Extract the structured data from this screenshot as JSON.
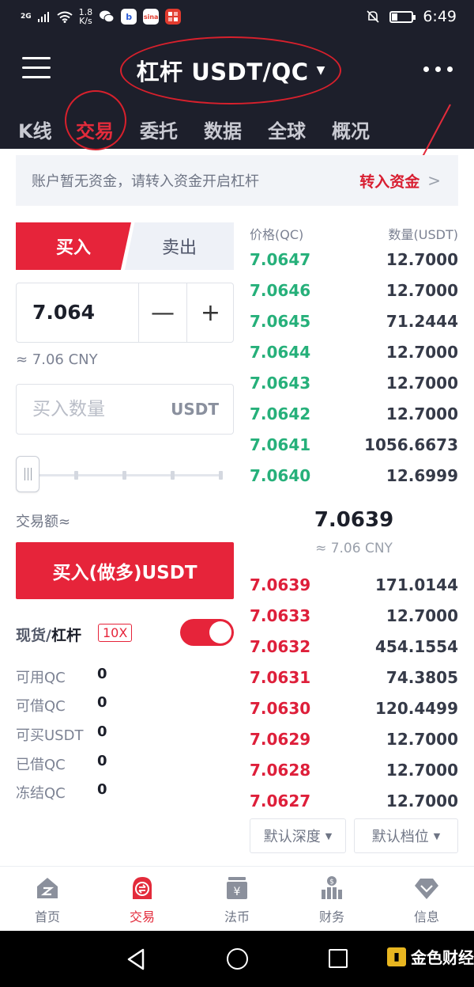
{
  "status_bar": {
    "signal": "2G",
    "net_speed": "1.8",
    "net_unit": "K/s",
    "time": "6:49",
    "battery_level": 0.3
  },
  "header": {
    "title": "杠杆 USDT/QC",
    "tabs": [
      {
        "label": "K线",
        "active": false
      },
      {
        "label": "交易",
        "active": true
      },
      {
        "label": "委托",
        "active": false
      },
      {
        "label": "数据",
        "active": false
      },
      {
        "label": "全球",
        "active": false
      },
      {
        "label": "概况",
        "active": false
      }
    ]
  },
  "notice": {
    "text": "账户暂无资金，请转入资金开启杠杆",
    "link": "转入资金"
  },
  "trade": {
    "buy_tab": "买入",
    "sell_tab": "卖出",
    "price_value": "7.064",
    "minus": "—",
    "plus": "+",
    "cny_hint": "≈ 7.06 CNY",
    "qty_placeholder": "买入数量",
    "qty_unit": "USDT",
    "slider_value": 0,
    "amount_label": "交易额≈",
    "buy_button": "买入(做多)USDT",
    "margin_spot": "现货/",
    "margin_lev": "杠杆",
    "leverage": "10X",
    "toggle_on": true,
    "balances": [
      {
        "label": "可用QC",
        "value": "0"
      },
      {
        "label": "可借QC",
        "value": "0"
      },
      {
        "label": "可买USDT",
        "value": "0"
      },
      {
        "label": "已借QC",
        "value": "0"
      },
      {
        "label": "冻结QC",
        "value": "0"
      }
    ]
  },
  "orderbook": {
    "price_header": "价格(QC)",
    "qty_header": "数量(USDT)",
    "asks": [
      {
        "price": "7.0647",
        "qty": "12.7000"
      },
      {
        "price": "7.0646",
        "qty": "12.7000"
      },
      {
        "price": "7.0645",
        "qty": "71.2444"
      },
      {
        "price": "7.0644",
        "qty": "12.7000"
      },
      {
        "price": "7.0643",
        "qty": "12.7000"
      },
      {
        "price": "7.0642",
        "qty": "12.7000"
      },
      {
        "price": "7.0641",
        "qty": "1056.6673"
      },
      {
        "price": "7.0640",
        "qty": "12.6999"
      }
    ],
    "last_price": "7.0639",
    "last_cny": "≈ 7.06 CNY",
    "bids": [
      {
        "price": "7.0639",
        "qty": "171.0144"
      },
      {
        "price": "7.0633",
        "qty": "12.7000"
      },
      {
        "price": "7.0632",
        "qty": "454.1554"
      },
      {
        "price": "7.0631",
        "qty": "74.3805"
      },
      {
        "price": "7.0630",
        "qty": "120.4499"
      },
      {
        "price": "7.0629",
        "qty": "12.7000"
      },
      {
        "price": "7.0628",
        "qty": "12.7000"
      },
      {
        "price": "7.0627",
        "qty": "12.7000"
      }
    ],
    "depth_select": "默认深度",
    "level_select": "默认档位"
  },
  "bottom_nav": [
    {
      "label": "首页",
      "icon": "home-icon",
      "active": false
    },
    {
      "label": "交易",
      "icon": "exchange-icon",
      "active": true
    },
    {
      "label": "法币",
      "icon": "fiat-icon",
      "active": false
    },
    {
      "label": "财务",
      "icon": "finance-icon",
      "active": false
    },
    {
      "label": "信息",
      "icon": "info-diamond-icon",
      "active": false
    }
  ],
  "watermark": "金色财经",
  "colors": {
    "header_bg": "#1d1f2b",
    "accent_red": "#e6243a",
    "ask_green": "#26b07a",
    "bid_red": "#de1f3a"
  }
}
